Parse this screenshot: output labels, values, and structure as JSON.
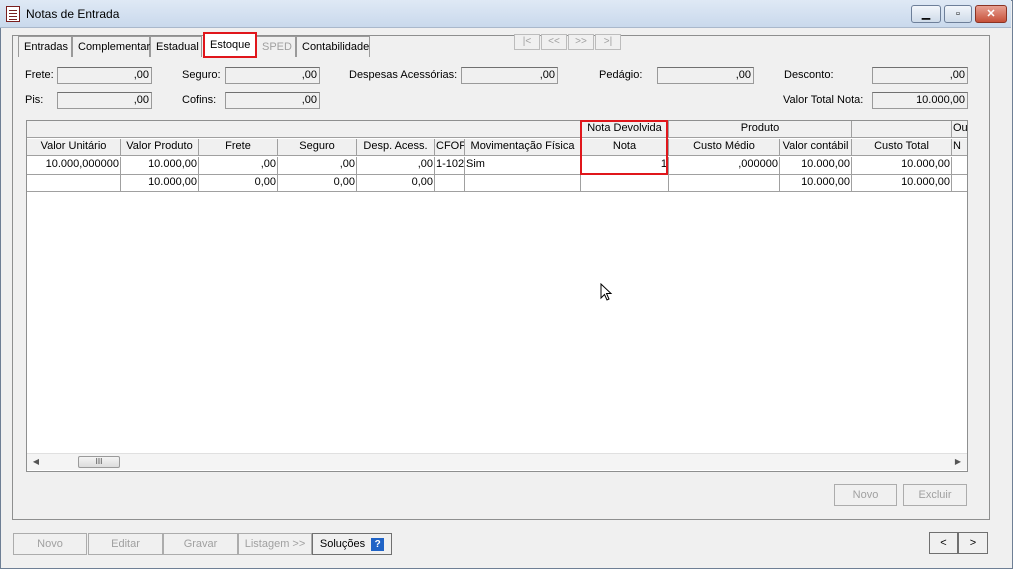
{
  "window": {
    "title": "Notas de Entrada"
  },
  "tabs": [
    "Entradas",
    "Complementar",
    "Estadual",
    "Estoque",
    "SPED",
    "Contabilidade"
  ],
  "nav": [
    "|<",
    "<<",
    ">>",
    ">|"
  ],
  "fields": {
    "frete": {
      "label": "Frete:",
      "value": ",00"
    },
    "seguro": {
      "label": "Seguro:",
      "value": ",00"
    },
    "despesas": {
      "label": "Despesas Acessórias:",
      "value": ",00"
    },
    "pedagio": {
      "label": "Pedágio:",
      "value": ",00"
    },
    "desconto": {
      "label": "Desconto:",
      "value": ",00"
    },
    "pis": {
      "label": "Pis:",
      "value": ",00"
    },
    "cofins": {
      "label": "Cofins:",
      "value": ",00"
    },
    "valor_total": {
      "label": "Valor Total Nota:",
      "value": "10.000,00"
    }
  },
  "grid": {
    "groups": [
      "Nota Devolvida",
      "Produto",
      "Ou"
    ],
    "headers": [
      "Valor Unitário",
      "Valor Produto",
      "Frete",
      "Seguro",
      "Desp. Acess.",
      "CFOP",
      "Movimentação Física",
      "Nota",
      "Custo Médio",
      "Valor contábil",
      "Custo Total",
      "N"
    ],
    "rows": [
      [
        "10.000,000000",
        "10.000,00",
        ",00",
        ",00",
        ",00",
        "1-102",
        "Sim",
        "1",
        ",000000",
        "10.000,00",
        "10.000,00",
        ""
      ],
      [
        "",
        "10.000,00",
        "0,00",
        "0,00",
        "0,00",
        "",
        "",
        "",
        "",
        "10.000,00",
        "10.000,00",
        ""
      ]
    ],
    "scroll_thumb_label": "III"
  },
  "grid_buttons": {
    "novo": "Novo",
    "excluir": "Excluir"
  },
  "footer": {
    "novo": "Novo",
    "editar": "Editar",
    "gravar": "Gravar",
    "listagem": "Listagem >>",
    "solucoes": "Soluções",
    "prev": "<",
    "next": ">"
  },
  "colors": {
    "highlight": "#e0161b",
    "help_icon": "#1f63c6"
  }
}
